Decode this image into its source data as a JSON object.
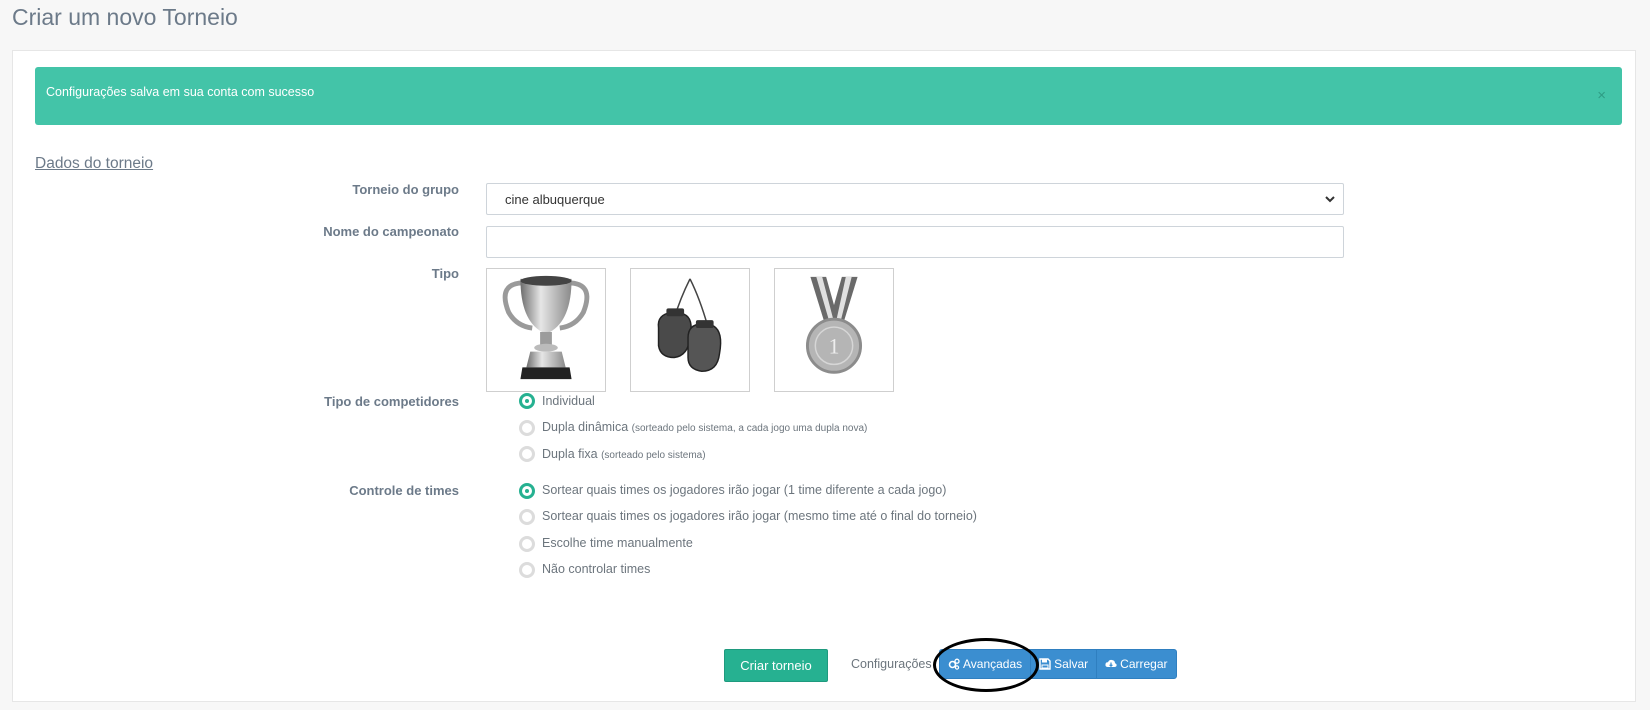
{
  "page": {
    "title": "Criar um novo Torneio"
  },
  "alert": {
    "message": "Configurações salva em sua conta com sucesso",
    "close": "×"
  },
  "section": {
    "title": "Dados do torneio"
  },
  "form": {
    "group_label": "Torneio do grupo",
    "group_value": "cine albuquerque",
    "name_label": "Nome do campeonato",
    "name_value": "",
    "type_label": "Tipo",
    "type_options": [
      "trophy-icon",
      "boxing-gloves-icon",
      "medal-icon"
    ],
    "medal_number": "1",
    "competitors_label": "Tipo de competidores",
    "competitors": [
      {
        "label": "Individual",
        "note": "",
        "checked": true
      },
      {
        "label": "Dupla dinâmica",
        "note": "(sorteado pelo sistema, a cada jogo uma dupla nova)",
        "checked": false
      },
      {
        "label": "Dupla fixa",
        "note": "(sorteado pelo sistema)",
        "checked": false
      }
    ],
    "teams_label": "Controle de times",
    "teams": [
      {
        "label": "Sortear quais times os jogadores irão jogar (1 time diferente a cada jogo)",
        "checked": true
      },
      {
        "label": "Sortear quais times os jogadores irão jogar (mesmo time até o final do torneio)",
        "checked": false
      },
      {
        "label": "Escolhe time manualmente",
        "checked": false
      },
      {
        "label": "Não controlar times",
        "checked": false
      }
    ]
  },
  "actions": {
    "create_label": "Criar torneio",
    "config_label": "Configurações",
    "advanced_label": "Avançadas",
    "save_label": "Salvar",
    "load_label": "Carregar"
  },
  "colors": {
    "accent": "#26b191",
    "alert": "#43c4a8",
    "button_blue": "#3b8ed0",
    "highlight": "#000000"
  }
}
